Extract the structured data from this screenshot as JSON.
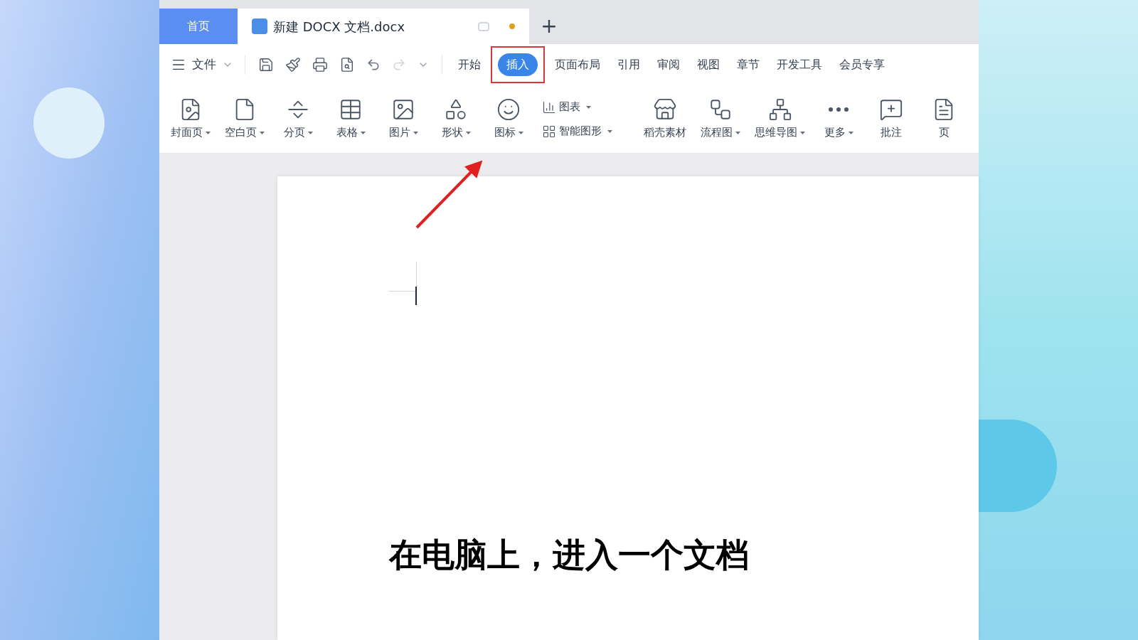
{
  "home_tab": {
    "label": "首页"
  },
  "document_tabs": [
    {
      "title": "新建 DOCX 文档.docx",
      "selected": true,
      "unsaved": true
    }
  ],
  "new_tab_button": {
    "label": "+"
  },
  "menu": {
    "file_label": "文件",
    "ribbon_tabs": [
      {
        "label": "开始",
        "selected": false,
        "highlighted": false
      },
      {
        "label": "插入",
        "selected": true,
        "highlighted": true
      },
      {
        "label": "页面布局",
        "selected": false,
        "highlighted": false
      },
      {
        "label": "引用",
        "selected": false,
        "highlighted": false
      },
      {
        "label": "审阅",
        "selected": false,
        "highlighted": false
      },
      {
        "label": "视图",
        "selected": false,
        "highlighted": false
      },
      {
        "label": "章节",
        "selected": false,
        "highlighted": false
      },
      {
        "label": "开发工具",
        "selected": false,
        "highlighted": false
      },
      {
        "label": "会员专享",
        "selected": false,
        "highlighted": false
      }
    ]
  },
  "ribbon": {
    "items": [
      {
        "kind": "large",
        "label": "封面页",
        "dropdown": true
      },
      {
        "kind": "large",
        "label": "空白页",
        "dropdown": true
      },
      {
        "kind": "large",
        "label": "分页",
        "dropdown": true
      },
      {
        "kind": "large",
        "label": "表格",
        "dropdown": true
      },
      {
        "kind": "large",
        "label": "图片",
        "dropdown": true
      },
      {
        "kind": "large",
        "label": "形状",
        "dropdown": true
      },
      {
        "kind": "large",
        "label": "图标",
        "dropdown": true
      },
      {
        "kind": "small",
        "label": "图表",
        "dropdown": true
      },
      {
        "kind": "small",
        "label": "智能图形",
        "dropdown": true
      },
      {
        "kind": "large",
        "label": "稻壳素材",
        "dropdown": false
      },
      {
        "kind": "large",
        "label": "流程图",
        "dropdown": true
      },
      {
        "kind": "large",
        "label": "思维导图",
        "dropdown": true
      },
      {
        "kind": "large",
        "label": "更多",
        "dropdown": true
      },
      {
        "kind": "large",
        "label": "批注",
        "dropdown": false
      },
      {
        "kind": "large",
        "label": "页",
        "dropdown": false
      }
    ]
  },
  "caption": "在电脑上，进入一个文档"
}
